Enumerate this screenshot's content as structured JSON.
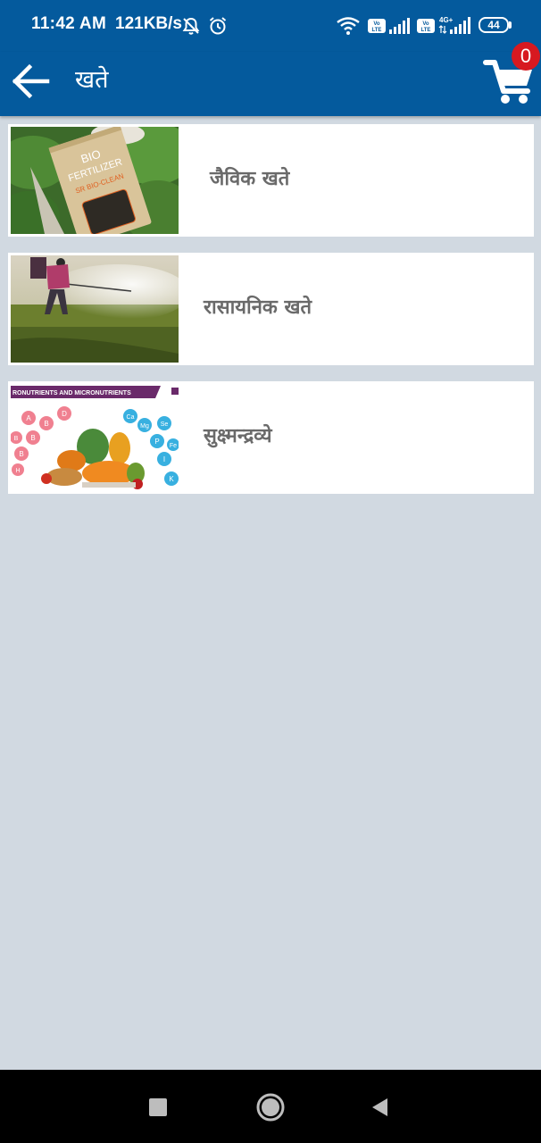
{
  "status_bar": {
    "time": "11:42 AM",
    "network_speed": "121KB/s",
    "volte_label": "Vo LTE",
    "network_type": "4G+",
    "battery_level": "44"
  },
  "app_bar": {
    "title": "खते",
    "cart_count": "0"
  },
  "categories": [
    {
      "label": "जैविक खते",
      "image": {
        "bag_text_1": "BIO",
        "bag_text_2": "FERTILIZER",
        "bag_text_3": "SR BIO-CLEAN"
      }
    },
    {
      "label": "रासायनिक खते"
    },
    {
      "label": "सुक्ष्मन्द्रव्ये",
      "image": {
        "banner": "RONUTRIENTS AND MICRONUTRIENTS",
        "bubbles": [
          "A",
          "B",
          "D",
          "B",
          "B",
          "B",
          "H",
          "Ca",
          "Mg",
          "Se",
          "P",
          "Fe",
          "I",
          "K"
        ]
      }
    }
  ],
  "colors": {
    "primary": "#045a9d",
    "background": "#d1d9e1",
    "card": "#ffffff",
    "label_text": "#6a6a6a",
    "badge": "#d71920"
  },
  "icons": {
    "back": "arrow-back-icon",
    "cart": "shopping-cart-icon",
    "nav_recent": "square-icon",
    "nav_home": "circle-icon",
    "nav_back": "triangle-back-icon"
  }
}
